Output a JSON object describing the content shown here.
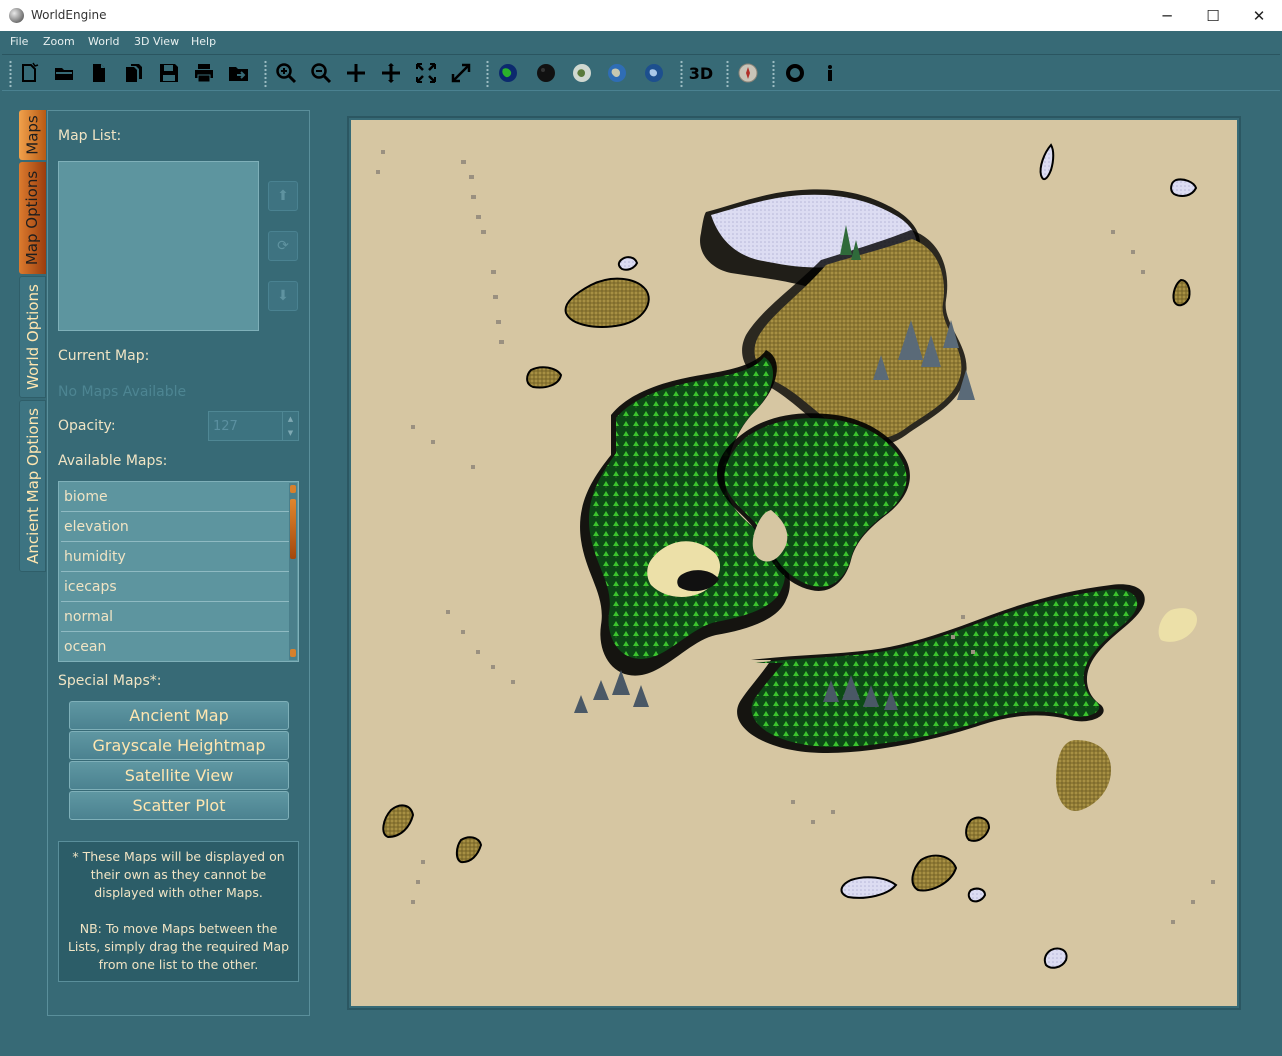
{
  "window": {
    "title": "WorldEngine",
    "minimize": "─",
    "maximize": "☐",
    "close": "✕"
  },
  "menu": [
    "File",
    "Zoom",
    "World",
    "3D View",
    "Help"
  ],
  "toolbar": {
    "file_tools": [
      "new-document-icon",
      "open-folder-icon",
      "document-icon",
      "copy-document-icon",
      "save-icon",
      "print-icon",
      "export-folder-icon"
    ],
    "zoom_tools": [
      "zoom-in-icon",
      "zoom-out-icon",
      "move-icon",
      "move-cross-icon",
      "fit-screen-icon",
      "expand-icon"
    ],
    "world_tools": [
      "globe-green-icon",
      "globe-dark-icon",
      "globe-light-icon",
      "globe-earth-icon",
      "globe-blue-icon"
    ],
    "view3d_label": "3D",
    "extra_tools": [
      "compass-icon",
      "lifebuoy-icon",
      "info-icon"
    ]
  },
  "tabs": [
    "Maps",
    "Map Options",
    "World Options",
    "Ancient Map Options"
  ],
  "panel": {
    "map_list_label": "Map List:",
    "current_map_label": "Current Map:",
    "current_map_value": "No Maps Available",
    "opacity_label": "Opacity:",
    "opacity_value": "127",
    "available_maps_label": "Available Maps:",
    "available_maps": [
      "biome",
      "elevation",
      "humidity",
      "icecaps",
      "normal",
      "ocean"
    ],
    "special_maps_label": "Special Maps*:",
    "special_maps": [
      "Ancient Map",
      "Grayscale Heightmap",
      "Satellite View",
      "Scatter Plot"
    ],
    "note_1": "* These Maps will be displayed on their own as they cannot be displayed with other Maps.",
    "note_2": "NB: To move Maps between the Lists, simply drag the required Map from one list to the other."
  },
  "colors": {
    "background": "#376a76",
    "parchment": "#d6c6a2",
    "forest": "#0b4a14",
    "tree_green": "#39c22c",
    "sand": "#a08a3a",
    "ice": "#dcdcf4",
    "accent_orange": "#dc7b2e"
  }
}
